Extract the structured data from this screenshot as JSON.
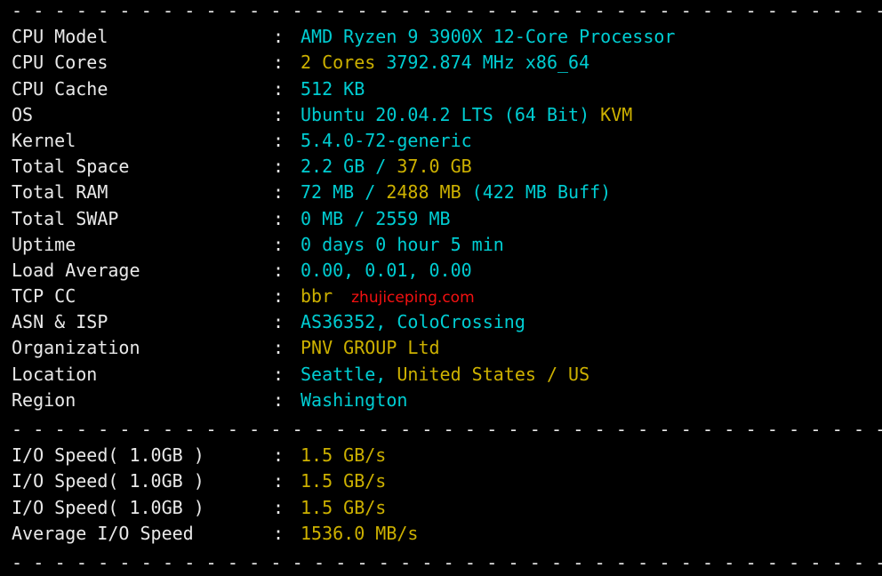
{
  "terminal": {
    "background": "#000000",
    "label_color": "#e9e9e9",
    "cyan": "#00cdd2",
    "yellow": "#cdb100",
    "red": "#f41111",
    "separator": "- - - - - - - - - - - - - - - - - - - - - - - - - - - - - - - - - - - - - - - - - - - - - - - - - - - - - - - - - -",
    "colon": ":",
    "watermark": "zhujiceping.com"
  },
  "system": {
    "rows": [
      {
        "label": "CPU Model",
        "parts": [
          {
            "text": "AMD Ryzen 9 3900X 12-Core Processor",
            "color": "cyan"
          }
        ]
      },
      {
        "label": "CPU Cores",
        "parts": [
          {
            "text": "2 Cores ",
            "color": "yellow"
          },
          {
            "text": "3792.874 MHz x86_64",
            "color": "cyan"
          }
        ]
      },
      {
        "label": "CPU Cache",
        "parts": [
          {
            "text": "512 KB",
            "color": "cyan"
          }
        ]
      },
      {
        "label": "OS",
        "parts": [
          {
            "text": "Ubuntu 20.04.2 LTS (64 Bit) ",
            "color": "cyan"
          },
          {
            "text": "KVM",
            "color": "yellow"
          }
        ]
      },
      {
        "label": "Kernel",
        "parts": [
          {
            "text": "5.4.0-72-generic",
            "color": "cyan"
          }
        ]
      },
      {
        "label": "Total Space",
        "parts": [
          {
            "text": "2.2 GB / ",
            "color": "cyan"
          },
          {
            "text": "37.0 GB",
            "color": "yellow"
          }
        ]
      },
      {
        "label": "Total RAM",
        "parts": [
          {
            "text": "72 MB / ",
            "color": "cyan"
          },
          {
            "text": "2488 MB ",
            "color": "yellow"
          },
          {
            "text": "(422 MB Buff)",
            "color": "cyan"
          }
        ]
      },
      {
        "label": "Total SWAP",
        "parts": [
          {
            "text": "0 MB / 2559 MB",
            "color": "cyan"
          }
        ]
      },
      {
        "label": "Uptime",
        "parts": [
          {
            "text": "0 days 0 hour 5 min",
            "color": "cyan"
          }
        ]
      },
      {
        "label": "Load Average",
        "parts": [
          {
            "text": "0.00, 0.01, 0.00",
            "color": "cyan"
          }
        ]
      },
      {
        "label": "TCP CC",
        "parts": [
          {
            "text": "bbr",
            "color": "yellow"
          }
        ],
        "watermark": "zhujiceping.com"
      },
      {
        "label": "ASN & ISP",
        "parts": [
          {
            "text": "AS36352, ColoCrossing",
            "color": "cyan"
          }
        ]
      },
      {
        "label": "Organization",
        "parts": [
          {
            "text": "PNV GROUP Ltd",
            "color": "yellow"
          }
        ]
      },
      {
        "label": "Location",
        "parts": [
          {
            "text": "Seattle, ",
            "color": "cyan"
          },
          {
            "text": "United States / US",
            "color": "yellow"
          }
        ]
      },
      {
        "label": "Region",
        "parts": [
          {
            "text": "Washington",
            "color": "cyan"
          }
        ]
      }
    ]
  },
  "io": {
    "rows": [
      {
        "label": "I/O Speed( 1.0GB )",
        "parts": [
          {
            "text": "1.5 GB/s",
            "color": "yellow"
          }
        ]
      },
      {
        "label": "I/O Speed( 1.0GB )",
        "parts": [
          {
            "text": "1.5 GB/s",
            "color": "yellow"
          }
        ]
      },
      {
        "label": "I/O Speed( 1.0GB )",
        "parts": [
          {
            "text": "1.5 GB/s",
            "color": "yellow"
          }
        ]
      },
      {
        "label": "Average I/O Speed",
        "parts": [
          {
            "text": "1536.0 MB/s",
            "color": "yellow"
          }
        ]
      }
    ]
  }
}
